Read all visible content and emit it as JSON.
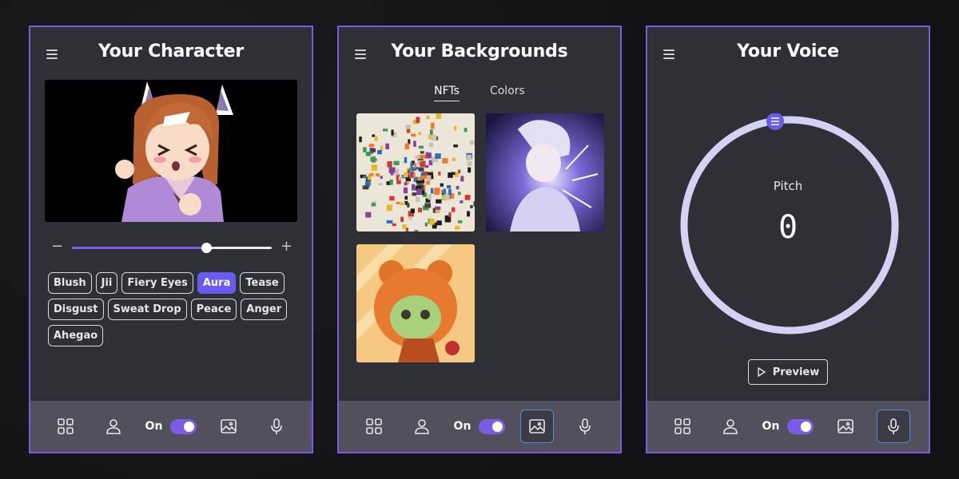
{
  "character": {
    "title": "Your Character",
    "slider": {
      "minus": "−",
      "plus": "+",
      "value": 0.67
    },
    "expressions": [
      {
        "label": "Blush",
        "active": false
      },
      {
        "label": "Jii",
        "active": false
      },
      {
        "label": "Fiery Eyes",
        "active": false
      },
      {
        "label": "Aura",
        "active": true
      },
      {
        "label": "Tease",
        "active": false
      },
      {
        "label": "Disgust",
        "active": false
      },
      {
        "label": "Sweat Drop",
        "active": false
      },
      {
        "label": "Peace",
        "active": false
      },
      {
        "label": "Anger",
        "active": false
      },
      {
        "label": "Ahegao",
        "active": false
      }
    ]
  },
  "backgrounds": {
    "title": "Your Backgrounds",
    "tabs": [
      {
        "label": "NFTs",
        "active": true
      },
      {
        "label": "Colors",
        "active": false
      }
    ]
  },
  "voice": {
    "title": "Your Voice",
    "pitch_label": "Pitch",
    "pitch_value": "0",
    "preview_label": "Preview"
  },
  "nav": {
    "toggle_label": "On",
    "toggle_on": true
  },
  "colors": {
    "accent": "#7c5ce6",
    "panel_bg": "#2f2f36",
    "nav_bg": "#52505c",
    "active_chip": "#6a5bf0",
    "active_nav_border": "#4a8fd6"
  },
  "icons": [
    "menu-icon",
    "grid-icon",
    "user-icon",
    "image-icon",
    "microphone-icon",
    "play-icon",
    "dial-handle-icon"
  ]
}
